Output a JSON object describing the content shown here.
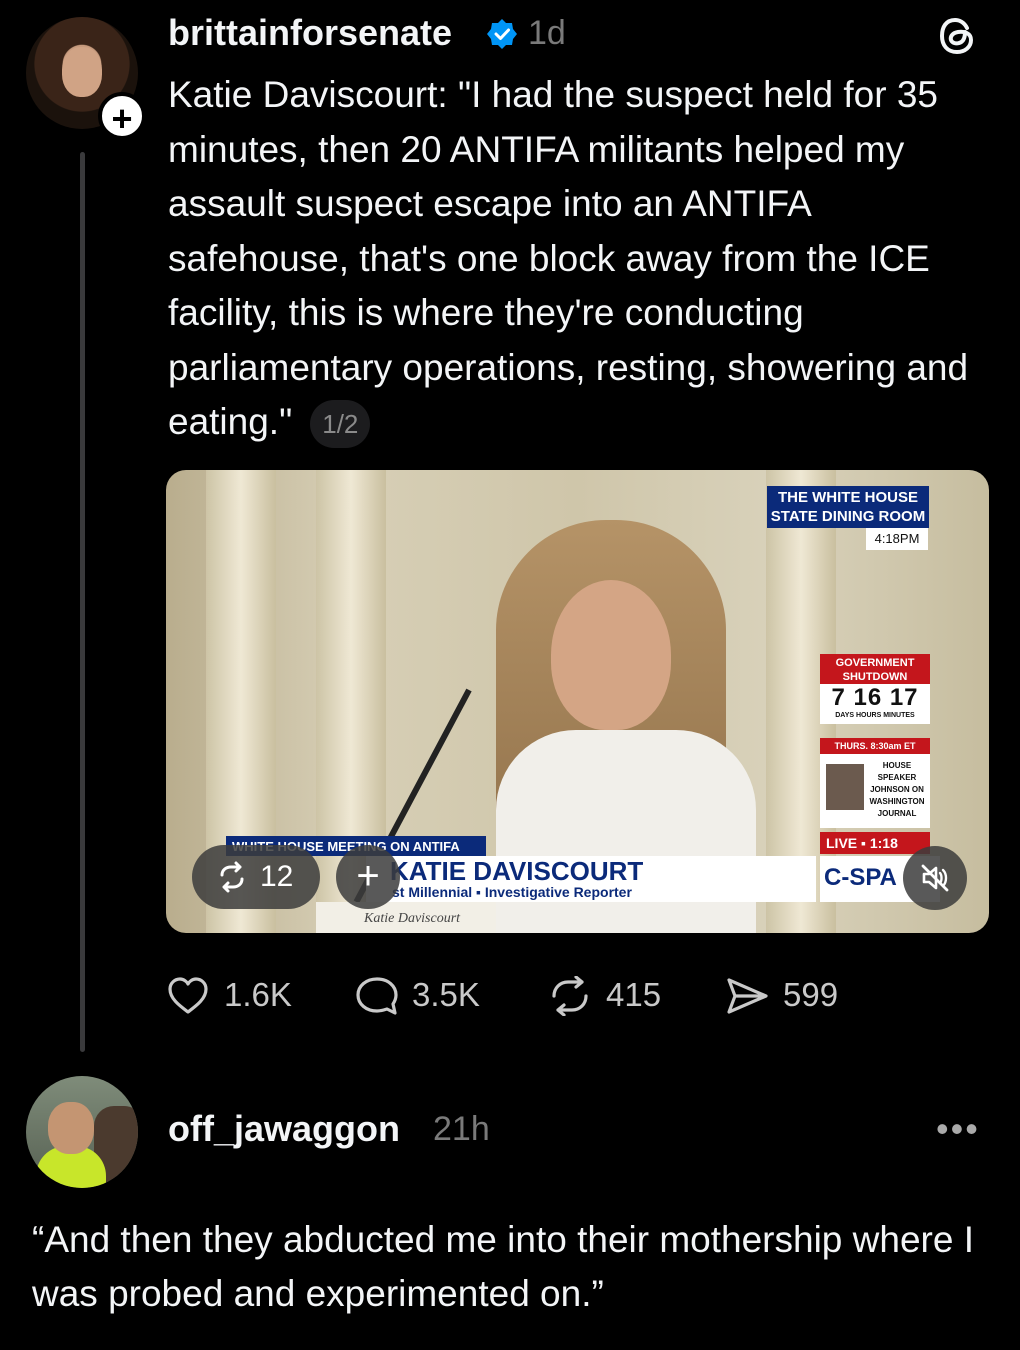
{
  "post": {
    "username": "brittainforsenate",
    "verified": true,
    "timestamp": "1d",
    "text": "Katie Daviscourt: \"I had the suspect held for 35 minutes, then 20 ANTIFA militants helped my assault suspect escape into an ANTIFA safehouse, that's one block away from the ICE facility, this is where they're conducting parliamentary operations, resting, showering and eating.\"",
    "page_indicator": "1/2",
    "video": {
      "location_line1": "THE WHITE HOUSE",
      "location_line2": "STATE DINING ROOM",
      "time": "4:18PM",
      "shutdown_label": "GOVERNMENT SHUTDOWN",
      "shutdown_count": "7 16 17",
      "shutdown_units": "DAYS  HOURS  MINUTES",
      "upcoming_time": "THURS. 8:30am ET",
      "upcoming_program": "HOUSE SPEAKER JOHNSON ON WASHINGTON JOURNAL",
      "live_label": "LIVE ▪ 1:18",
      "strip_title": "WHITE HOUSE MEETING ON ANTIFA",
      "name_title": "KATIE DAVISCOURT",
      "name_subtitle": "st Millennial ▪ Investigative Reporter",
      "network": "C-SPA",
      "nameplate": "Katie Daviscourt",
      "repost_count": "12"
    },
    "actions": {
      "likes": "1.6K",
      "comments": "3.5K",
      "reposts": "415",
      "shares": "599"
    }
  },
  "reply": {
    "username": "off_jawaggon",
    "timestamp": "21h",
    "more": "•••",
    "text": "“And then they abducted me into their mothership where I was probed and experimented on.”"
  },
  "colors": {
    "background": "#000000",
    "text": "#f3f5f7",
    "muted": "#7a7a7a",
    "verified": "#0095f6",
    "thread_line": "#3a3a3c"
  },
  "icons": [
    "verified-badge-icon",
    "threads-logo-icon",
    "repost-icon",
    "plus-icon",
    "mute-icon",
    "heart-icon",
    "comment-icon",
    "share-icon",
    "more-icon"
  ]
}
